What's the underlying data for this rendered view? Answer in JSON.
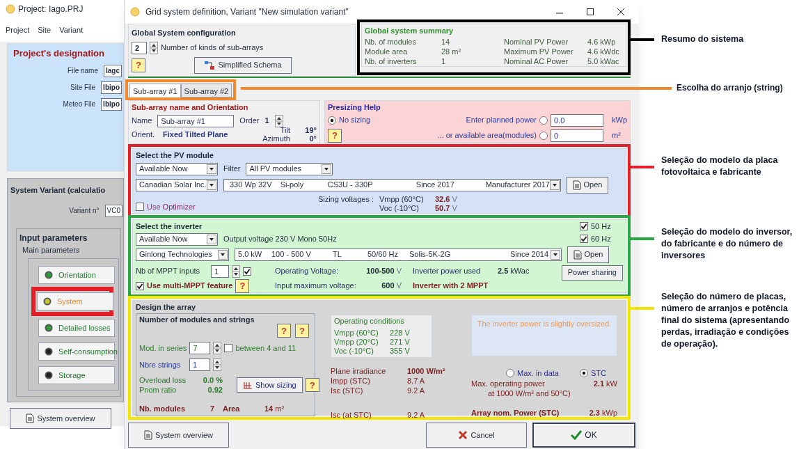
{
  "project_window": {
    "title": "Project:  Iago.PRJ",
    "menu": [
      "Project",
      "Site",
      "Variant"
    ],
    "designation": {
      "title": "Project's designation",
      "fields": [
        {
          "label": "File name",
          "value": "Iagc"
        },
        {
          "label": "Site File",
          "value": "Ibipo"
        },
        {
          "label": "Meteo File",
          "value": "Ibipo"
        }
      ]
    },
    "variant": {
      "title": "System Variant (calculatio",
      "label": "Variant n°",
      "value": "VC0"
    },
    "input_parameters": {
      "title": "Input parameters",
      "subtitle": "Main parameters",
      "buttons": [
        {
          "label": "Orientation",
          "selected": false,
          "color": "#2a9d3a"
        },
        {
          "label": "System",
          "selected": true,
          "color": "#c8c832"
        },
        {
          "label": "Detailed losses",
          "selected": false,
          "color": "#2a9d3a"
        },
        {
          "label": "Self-consumption",
          "selected": false,
          "color": "#222222"
        },
        {
          "label": "Storage",
          "selected": false,
          "color": "#222222"
        }
      ]
    },
    "overview_button": "System overview"
  },
  "dialog": {
    "title": "Grid system definition, Variant  \"New simulation variant\"",
    "global_config": {
      "title": "Global System configuration",
      "count": "2",
      "count_label": "Number of kinds of sub-arrays",
      "help": "?",
      "schema_button": "Simplified Schema"
    },
    "summary": {
      "title": "Global system summary",
      "left": [
        {
          "label": "Nb. of modules",
          "value": "14"
        },
        {
          "label": "Module area",
          "value": "28 m²"
        },
        {
          "label": "Nb. of inverters",
          "value": "1"
        }
      ],
      "right": [
        {
          "label": "Nominal PV Power",
          "value": "4.6  kWp"
        },
        {
          "label": "Maximum PV Power",
          "value": "4.6  kWdc"
        },
        {
          "label": "Nominal AC Power",
          "value": "5.0  kWac"
        }
      ]
    },
    "tabs": [
      {
        "label": "Sub-array #1",
        "selected": true
      },
      {
        "label": "Sub-array #2",
        "selected": false
      }
    ],
    "subarray": {
      "title": "Sub-array name and Orientation",
      "name_label": "Name",
      "name_value": "Sub-array #1",
      "order_label": "Order",
      "order_value": "1",
      "orient_label": "Orient.",
      "orient_value": "Fixed Tilted Plane",
      "tilt_label": "Tilt",
      "tilt_value": "19°",
      "azimuth_label": "Azimuth",
      "azimuth_value": "0°"
    },
    "presizing": {
      "title": "Presizing Help",
      "help": "?",
      "options": [
        {
          "label": "No sizing",
          "selected": true
        },
        {
          "label": "Enter planned power",
          "selected": false,
          "value": "0.0",
          "unit": "kWp"
        },
        {
          "label": "... or available area(modules)",
          "selected": false,
          "value": "0",
          "unit": "m²"
        }
      ]
    },
    "pv_module": {
      "title": "Select the PV module",
      "availability": "Available Now",
      "filter_label": "Filter",
      "filter": "All PV modules",
      "manufacturer": "Canadian Solar Inc.",
      "model": [
        "330 Wp 32V",
        "Si-poly",
        "CS3U - 330P",
        "Since 2017",
        "Manufacturer 2017"
      ],
      "open_button": "Open",
      "sizing_label": "Sizing voltages :",
      "voltages": [
        {
          "label": "Vmpp (60°C)",
          "value": "32.6",
          "unit": "V"
        },
        {
          "label": "Voc  (-10°C)",
          "value": "50.7",
          "unit": "V"
        }
      ],
      "optimizer": {
        "label": "Use Optimizer",
        "checked": false
      }
    },
    "inverter": {
      "title": "Select the inverter",
      "availability": "Available Now",
      "output": "Output voltage 230 V Mono 50Hz",
      "frequencies": [
        {
          "label": "50 Hz",
          "checked": true
        },
        {
          "label": "60 Hz",
          "checked": true
        }
      ],
      "manufacturer": "Ginlong Technologies",
      "model": [
        "5.0 kW",
        "100 - 500 V",
        "TL",
        "50/60 Hz",
        "Solis-5K-2G",
        "Since 2014"
      ],
      "open_button": "Open",
      "mppt_label": "Nb of MPPT inputs",
      "mppt_value": "1",
      "mppt_checked": true,
      "multi_mppt": {
        "label": "Use multi-MPPT feature",
        "checked": true
      },
      "help": "?",
      "voltages": [
        {
          "label": "Operating Voltage:",
          "value": "100-500",
          "unit": "V"
        },
        {
          "label": "Input maximum voltage:",
          "value": "600",
          "unit": "V"
        }
      ],
      "power_label": "Inverter power used",
      "power_value": "2.5",
      "power_unit": "kWac",
      "note": "Inverter with 2 MPPT",
      "sharing_button": "Power sharing"
    },
    "design": {
      "title": "Design the array",
      "strings": {
        "title": "Number of modules and strings",
        "help": [
          "?",
          "?"
        ],
        "series_label": "Mod. in series",
        "series_value": "7",
        "between": {
          "label": "between 4 and 11",
          "checked": false
        },
        "strings_label": "Nbre strings",
        "strings_value": "1",
        "overload_label": "Overload loss",
        "overload_value": "0.0 %",
        "pnom_label": "Pnom ratio",
        "pnom_value": "0.92",
        "sizing_button": "Show sizing",
        "sizing_help": "?",
        "modules_label": "Nb. modules",
        "modules_value": "7",
        "area_label": "Area",
        "area_value": "14",
        "area_unit": "m²"
      },
      "conditions": {
        "title": "Operating conditions",
        "rows": [
          {
            "label": "Vmpp (60°C)",
            "value": "228  V"
          },
          {
            "label": "Vmpp (20°C)",
            "value": "271  V"
          },
          {
            "label": "Voc  (-10°C)",
            "value": "355  V"
          }
        ]
      },
      "message": "The inverter power is slightly oversized.",
      "irradiance": {
        "label": "Plane irradiance",
        "value": "1000 W/m²"
      },
      "currents": [
        {
          "label": "Impp (STC)",
          "value": "8.7 A"
        },
        {
          "label": "Isc  (STC)",
          "value": "9.2 A"
        }
      ],
      "isc_at_stc": {
        "label": "Isc (at STC)",
        "value": "9.2 A"
      },
      "power_mode": [
        {
          "label": "Max. in data",
          "selected": false
        },
        {
          "label": "STC",
          "selected": true
        }
      ],
      "max_power": {
        "label": "Max. operating power",
        "sublabel": "at 1000 W/m² and 50°C)",
        "value": "2.1",
        "unit": "kW"
      },
      "nominal_power": {
        "label": "Array nom. Power (STC)",
        "value": "2.3",
        "unit": "kWp"
      }
    },
    "buttons": {
      "overview": "System overview",
      "cancel": "Cancel",
      "ok": "OK"
    }
  },
  "annotations": [
    {
      "kind": "summary",
      "color": "#000000",
      "text": "Resumo do sistema"
    },
    {
      "kind": "tabs",
      "color": "#f08a30",
      "text": "Escolha do arranjo (string)"
    },
    {
      "kind": "pv_module",
      "color": "#e3202a",
      "text": "Seleção do modelo da placa fotovoltaica e fabricante"
    },
    {
      "kind": "inverter",
      "color": "#28a745",
      "text": "Seleção do modelo do inversor, do fabricante e do número de inversores"
    },
    {
      "kind": "design",
      "color": "#f2e600",
      "text": "Seleção do número de placas, número de arranjos e potência final do sistema (apresentando perdas, irradiação e condições de operação)."
    },
    {
      "kind": "system_button",
      "color": "#e3202a"
    }
  ]
}
